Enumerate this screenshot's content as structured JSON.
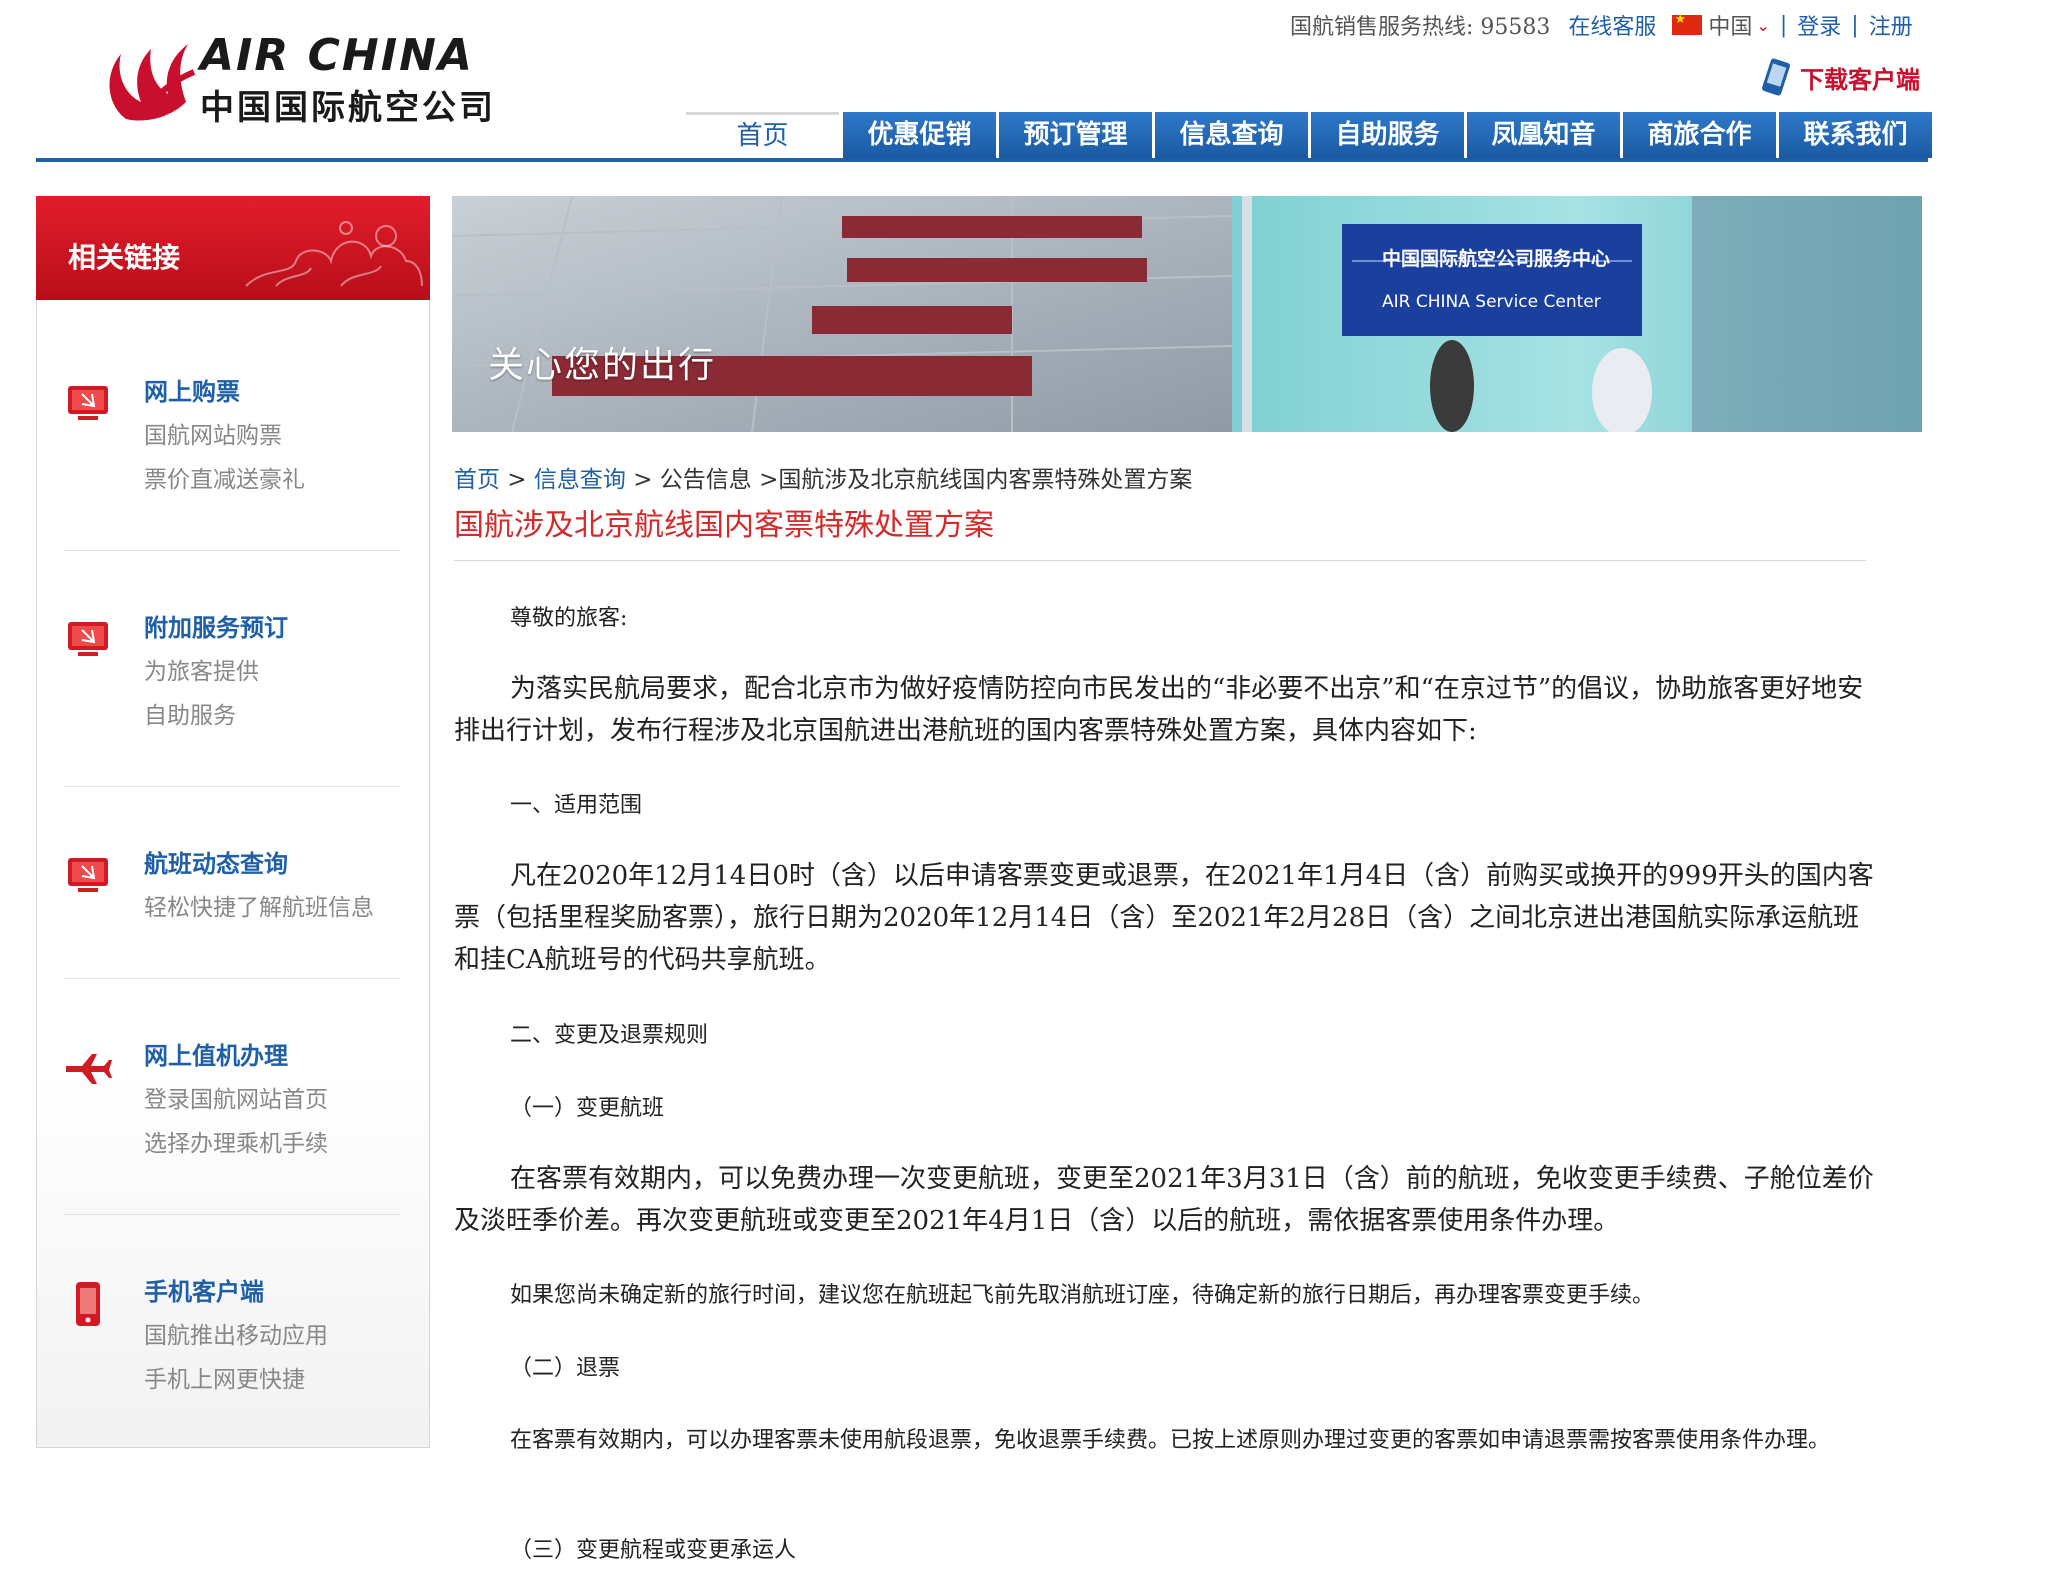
{
  "brand": {
    "name_en": "AIR CHINA",
    "name_cn": "中国国际航空公司"
  },
  "topbar": {
    "hotline_label": "国航销售服务热线: 95583",
    "online_service": "在线客服",
    "region": "中国",
    "login": "登录",
    "register": "注册",
    "download": "下载客户端"
  },
  "nav": {
    "tabs": [
      "首页",
      "优惠促销",
      "预订管理",
      "信息查询",
      "自助服务",
      "凤凰知音",
      "商旅合作",
      "联系我们"
    ]
  },
  "sidebar": {
    "heading": "相关链接",
    "groups": [
      {
        "title": "网上购票",
        "line1": "国航网站购票",
        "line2": "票价直减送豪礼",
        "icon": "monitor-icon"
      },
      {
        "title": "附加服务预订",
        "line1": "为旅客提供",
        "line2": "自助服务",
        "icon": "monitor-icon"
      },
      {
        "title": "航班动态查询",
        "line1": "轻松快捷了解航班信息",
        "line2": "",
        "icon": "monitor-icon"
      },
      {
        "title": "网上值机办理",
        "line1": "登录国航网站首页",
        "line2": "选择办理乘机手续",
        "icon": "airplane-icon"
      },
      {
        "title": "手机客户端",
        "line1": "国航推出移动应用",
        "line2": "手机上网更快捷",
        "icon": "mobile-phone-icon"
      }
    ]
  },
  "banner": {
    "caption": "关心您的出行",
    "sign_cn": "中国国际航空公司服务中心",
    "sign_en": "AIR CHINA Service Center"
  },
  "breadcrumb": {
    "home": "首页",
    "sep1": " > ",
    "info": "信息查询",
    "sep2": " > 公告信息 >",
    "current": "国航涉及北京航线国内客票特殊处置方案"
  },
  "article": {
    "title": "国航涉及北京航线国内客票特殊处置方案",
    "greeting": "尊敬的旅客:",
    "intro": "为落实民航局要求，配合北京市为做好疫情防控向市民发出的“非必要不出京”和“在京过节”的倡议，协助旅客更好地安排出行计划，发布行程涉及北京国航进出港航班的国内客票特殊处置方案，具体内容如下:",
    "section1": "一、适用范围",
    "scope": "凡在2020年12月14日0时（含）以后申请客票变更或退票，在2021年1月4日（含）前购买或换开的999开头的国内客票（包括里程奖励客票），旅行日期为2020年12月14日（含）至2021年2月28日（含）之间北京进出港国航实际承运航班和挂CA航班号的代码共享航班。",
    "section2": "二、变更及退票规则",
    "sub1": "（一）变更航班",
    "change_rule": "在客票有效期内，可以免费办理一次变更航班，变更至2021年3月31日（含）前的航班，免收变更手续费、子舱位差价及淡旺季价差。再次变更航班或变更至2021年4月1日（含）以后的航班，需依据客票使用条件办理。",
    "change_tip": "如果您尚未确定新的旅行时间，建议您在航班起飞前先取消航班订座，待确定新的旅行日期后，再办理客票变更手续。",
    "sub2": "（二）退票",
    "refund_rule": "在客票有效期内，可以办理客票未使用航段退票，免收退票手续费。已按上述原则办理过变更的客票如申请退票需按客票使用条件办理。",
    "sub3": "（三）变更航程或变更承运人"
  },
  "colors": {
    "brand_red": "#c8102e",
    "nav_blue": "#1f5fa8",
    "title_red": "#d42a2a"
  }
}
